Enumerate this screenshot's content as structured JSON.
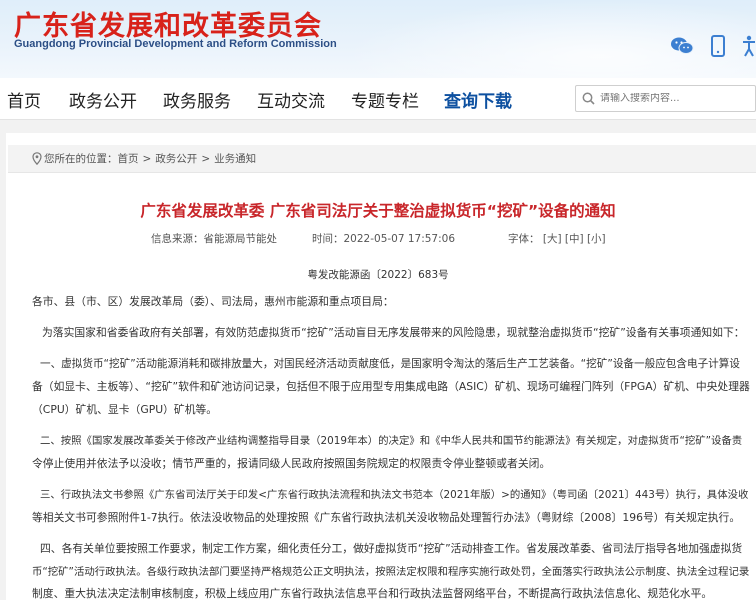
{
  "header": {
    "title": "广东省发展和改革委员会",
    "subtitle": "Guangdong Provincial Development and Reform Commission",
    "icons": [
      "wechat-icon",
      "mobile-icon",
      "accessibility-icon"
    ]
  },
  "nav": {
    "items": [
      "首页",
      "政务公开",
      "政务服务",
      "互动交流",
      "专题专栏",
      "查询下载"
    ],
    "active": "查询下载"
  },
  "search": {
    "placeholder": "请输入搜索内容..."
  },
  "breadcrumb": {
    "prefix": "您所在的位置：",
    "items": [
      "首页",
      "政务公开",
      "业务通知"
    ],
    "separator": ">"
  },
  "article": {
    "title": "广东省发展改革委 广东省司法厅关于整治虚拟货币“挖矿”设备的通知",
    "source": "信息来源：省能源局节能处",
    "time": "时间：2022-05-07 17:57:06",
    "size_label": "字体：",
    "sizes": [
      "[大]",
      "[中]",
      "[小]"
    ],
    "doc_no": "粤发改能源函〔2022〕683号",
    "lines": [
      "各市、县（市、区）发展改革局（委）、司法局，惠州市能源和重点项目局：",
      "为落实国家和省委省政府有关部署，有效防范虚拟货币“挖矿”活动盲目无序发展带来的风险隐患，现就整治虚拟货币“挖矿”设备有关事项通知如下：",
      "一、虚拟货币“挖矿”活动能源消耗和碳排放量大，对国民经济活动贡献度低，是国家明令淘汰的落后生产工艺装备。“挖矿”设备一般应包含电子计算设",
      "备（如显卡、主板等）、“挖矿”软件和矿池访问记录，包括但不限于应用型专用集成电路（ASIC）矿机、现场可编程门阵列（FPGA）矿机、中央处理器",
      "（CPU）矿机、显卡（GPU）矿机等。",
      "二、按照《国家发展改革委关于修改产业结构调整指导目录（2019年本）的决定》和《中华人民共和国节约能源法》有关规定，对虚拟货币“挖矿”设备责",
      "令停止使用并依法予以没收；情节严重的，报请同级人民政府按照国务院规定的权限责令停业整顿或者关闭。",
      "三、行政执法文书参照《广东省司法厅关于印发<广东省行政执法流程和执法文书范本（2021年版）>的通知》（粤司函〔2021〕443号）执行，具体没收",
      "等相关文书可参照附件1-7执行。依法没收物品的处理按照《广东省行政执法机关没收物品处理暂行办法》（粤财综〔2008〕196号）有关规定执行。",
      "四、各有关单位要按照工作要求，制定工作方案，细化责任分工，做好虚拟货币“挖矿”活动排查工作。省发展改革委、省司法厅指导各地加强虚拟货",
      "币“挖矿”活动行政执法。各级行政执法部门要坚持严格规范公正文明执法，按照法定权限和程序实施行政处罚，全面落实行政执法公示制度、执法全过程记录",
      "制度、重大执法决定法制审核制度，积极上线应用广东省行政执法信息平台和行政执法监督网络平台，不断提高行政执法信息化、规范化水平。"
    ]
  },
  "colors": {
    "title_red": "#d8221a",
    "nav_active": "#0d50a0",
    "article_title": "#c8262a"
  }
}
